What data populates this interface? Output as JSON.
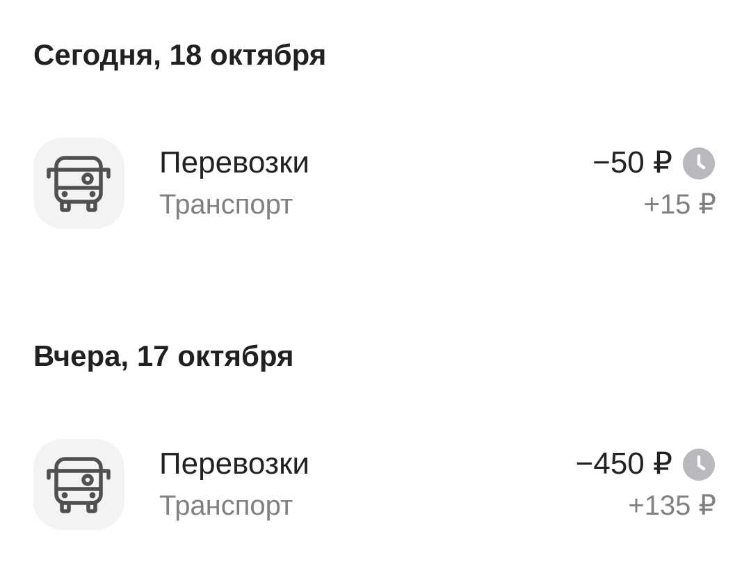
{
  "days": [
    {
      "header": "Сегодня, 18 октября",
      "transactions": [
        {
          "name": "Перевозки",
          "category": "Транспорт",
          "amount": "−50 ₽",
          "cashback": "+15 ₽",
          "icon": "bus-icon",
          "status_icon": "clock-icon"
        }
      ]
    },
    {
      "header": "Вчера, 17 октября",
      "transactions": [
        {
          "name": "Перевозки",
          "category": "Транспорт",
          "amount": "−450 ₽",
          "cashback": "+135 ₽",
          "icon": "bus-icon",
          "status_icon": "clock-icon"
        }
      ]
    }
  ],
  "colors": {
    "text_primary": "#212121",
    "text_secondary": "#808080",
    "icon_bg": "#f3f3f4",
    "icon_stroke": "#505050",
    "pending_badge": "#b8b8bd"
  }
}
